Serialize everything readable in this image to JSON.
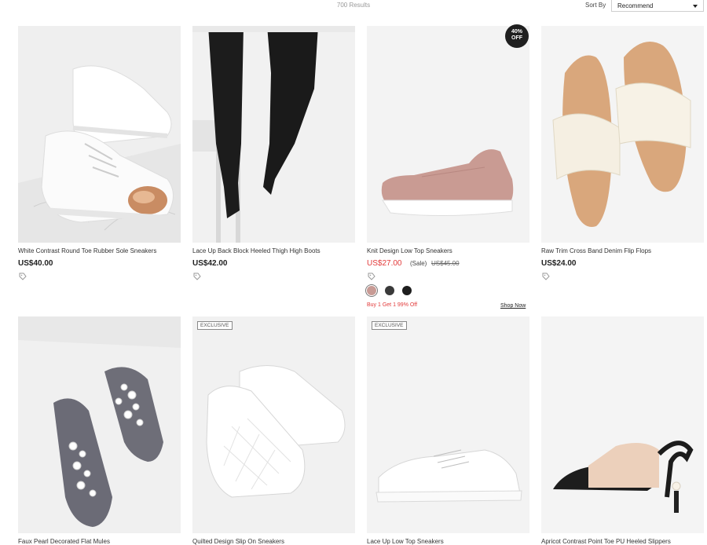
{
  "header": {
    "results_text": "700 Results",
    "sort_label": "Sort By",
    "sort_value": "Recommend"
  },
  "products": [
    {
      "title": "White Contrast Round Toe Rubber Sole Sneakers",
      "price": "US$40.00"
    },
    {
      "title": "Lace Up Back Block Heeled Thigh High Boots",
      "price": "US$42.00"
    },
    {
      "title": "Knit Design Low Top Sneakers",
      "price": "US$27.00",
      "sale_label": "(Sale)",
      "original_price": "US$45.00",
      "badge_line1": "40%",
      "badge_line2": "OFF",
      "swatches": [
        "#c89b95",
        "#3a3a3a",
        "#1e1e1e"
      ],
      "promo": "Buy 1 Get 1 99% Off",
      "shop_now": "Shop Now"
    },
    {
      "title": "Raw Trim Cross Band Denim Flip Flops",
      "price": "US$24.00"
    },
    {
      "title": "Faux Pearl Decorated Flat Mules"
    },
    {
      "title": "Quilted Design Slip On Sneakers",
      "tag": "EXCLUSIVE"
    },
    {
      "title": "Lace Up Low Top Sneakers",
      "tag": "EXCLUSIVE"
    },
    {
      "title": "Apricot Contrast Point Toe PU Heeled Slippers"
    }
  ],
  "colors": {
    "sale": "#e23a3a",
    "badge": "#1f1f1f"
  }
}
